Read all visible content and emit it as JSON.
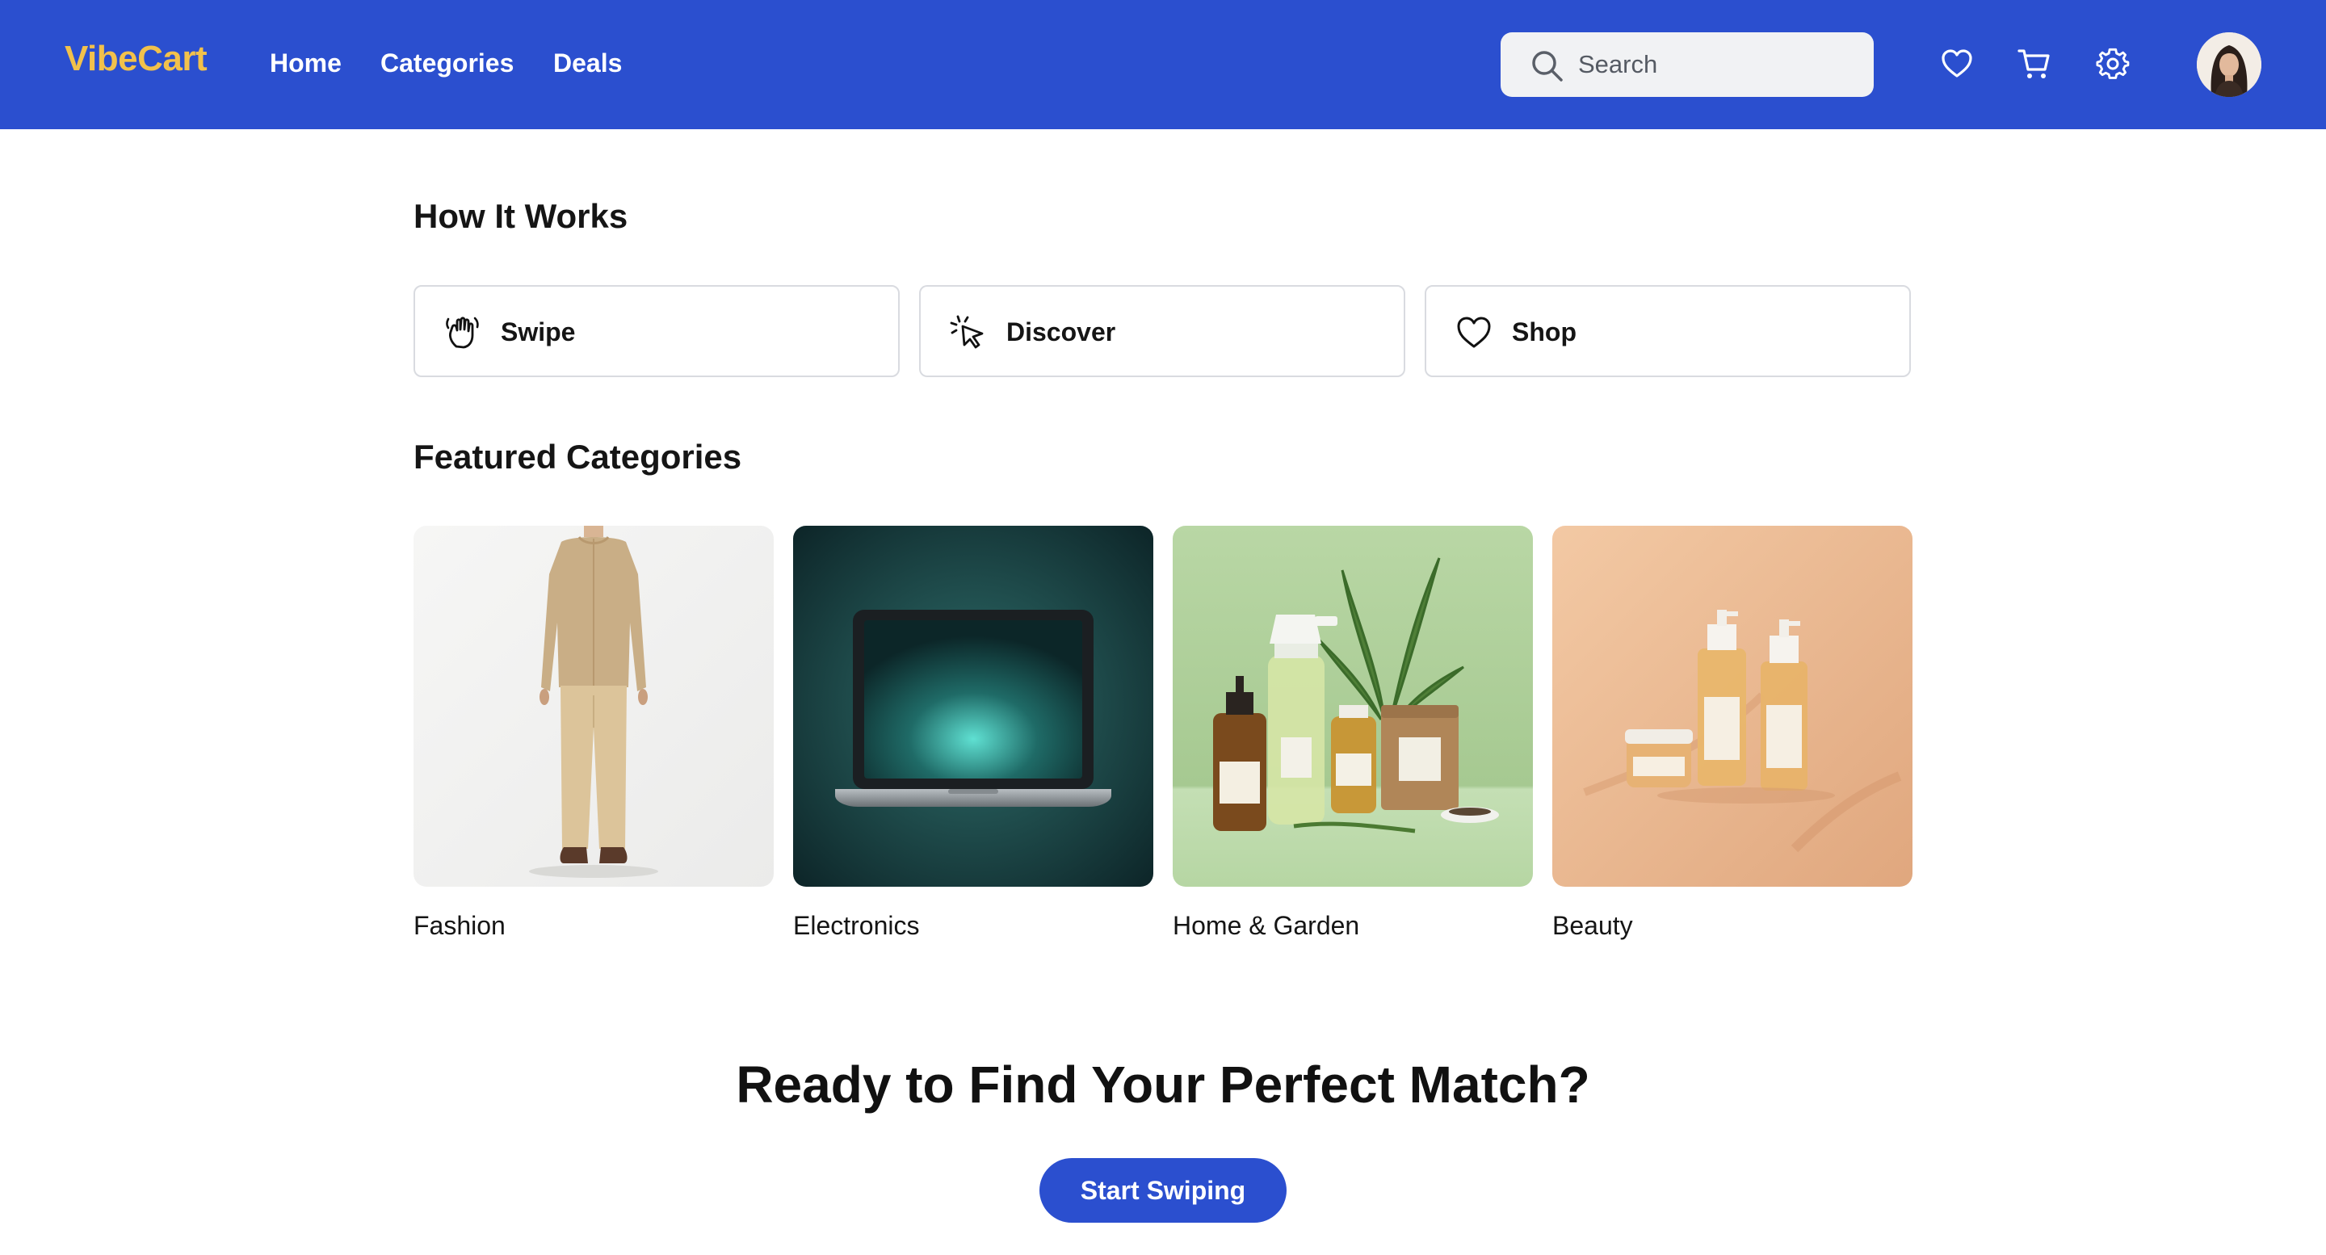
{
  "header": {
    "brand": "VibeCart",
    "nav": {
      "home": "Home",
      "categories": "Categories",
      "deals": "Deals"
    },
    "search": {
      "placeholder": "Search",
      "value": ""
    },
    "icons": [
      "search-icon",
      "heart-icon",
      "cart-icon",
      "gear-icon"
    ],
    "colors": {
      "bar": "#2b4fcf",
      "brand": "#f2c14b"
    }
  },
  "how_it_works": {
    "title": "How It Works",
    "steps": [
      {
        "label": "Swipe",
        "icon": "swipe-hand-icon"
      },
      {
        "label": "Discover",
        "icon": "cursor-click-icon"
      },
      {
        "label": "Shop",
        "icon": "heart-icon"
      }
    ]
  },
  "featured": {
    "title": "Featured Categories",
    "categories": [
      {
        "label": "Fashion"
      },
      {
        "label": "Electronics"
      },
      {
        "label": "Home & Garden"
      },
      {
        "label": "Beauty"
      }
    ]
  },
  "cta": {
    "title": "Ready to Find Your Perfect Match?",
    "button": "Start Swiping"
  }
}
